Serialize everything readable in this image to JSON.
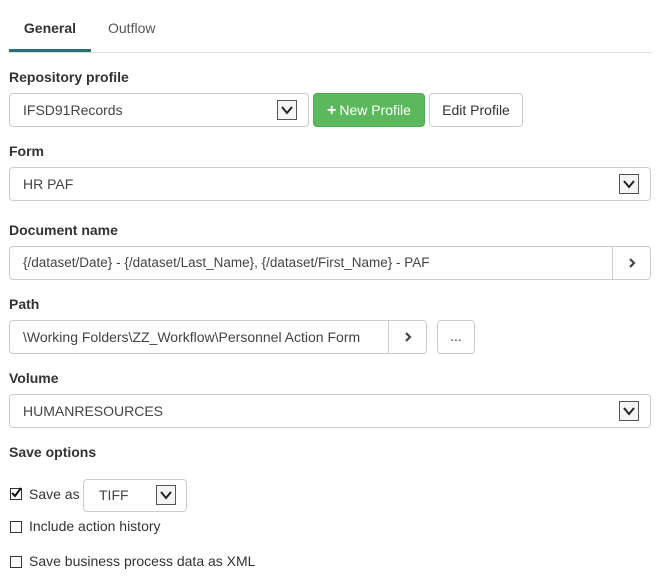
{
  "tabs": {
    "general": "General",
    "outflow": "Outflow"
  },
  "repository": {
    "label": "Repository profile",
    "value": "IFSD91Records",
    "new_profile": "New Profile",
    "edit_profile": "Edit Profile"
  },
  "form": {
    "label": "Form",
    "value": "HR PAF"
  },
  "document": {
    "label": "Document name",
    "value": "{/dataset/Date} - {/dataset/Last_Name}, {/dataset/First_Name} - PAF"
  },
  "path": {
    "label": "Path",
    "value": "\\Working Folders\\ZZ_Workflow\\Personnel Action Form",
    "browse": "..."
  },
  "volume": {
    "label": "Volume",
    "value": "HUMANRESOURCES"
  },
  "save_options": {
    "label": "Save options",
    "save_as_label": "Save as",
    "save_as_checked": true,
    "save_as_format": "TIFF",
    "include_history_label": "Include action history",
    "include_history_checked": false,
    "save_xml_label": "Save business process data as XML",
    "save_xml_checked": false
  },
  "icons": {
    "plus": "plus-icon",
    "chevron_right": "chevron-right-icon",
    "dropdown": "dropdown-arrow-icon",
    "check": "check-icon"
  },
  "colors": {
    "accent": "#2a6f78",
    "primary_button": "#5cb85c"
  }
}
